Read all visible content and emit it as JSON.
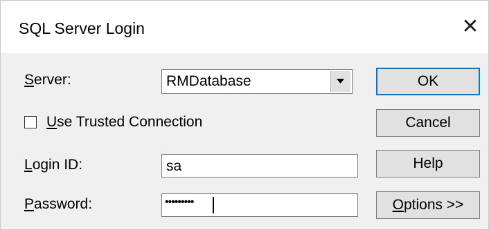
{
  "window": {
    "title": "SQL Server Login",
    "close_glyph": "✕"
  },
  "server": {
    "label_accel": "S",
    "label_rest": "erver:",
    "value": "RMDatabase"
  },
  "trusted": {
    "label_accel": "U",
    "label_rest": "se Trusted Connection",
    "checked": false
  },
  "login": {
    "label_accel": "L",
    "label_rest": "ogin ID:",
    "value": "sa"
  },
  "password": {
    "label_accel": "P",
    "label_rest": "assword:",
    "masked_value": "•••••••••"
  },
  "buttons": {
    "ok": "OK",
    "cancel": "Cancel",
    "help": "Help",
    "options_accel": "O",
    "options_rest": "ptions >>"
  },
  "colors": {
    "focus_border": "#0078d7",
    "dialog_bg": "#f0f0f0",
    "button_bg": "#e1e1e1"
  }
}
